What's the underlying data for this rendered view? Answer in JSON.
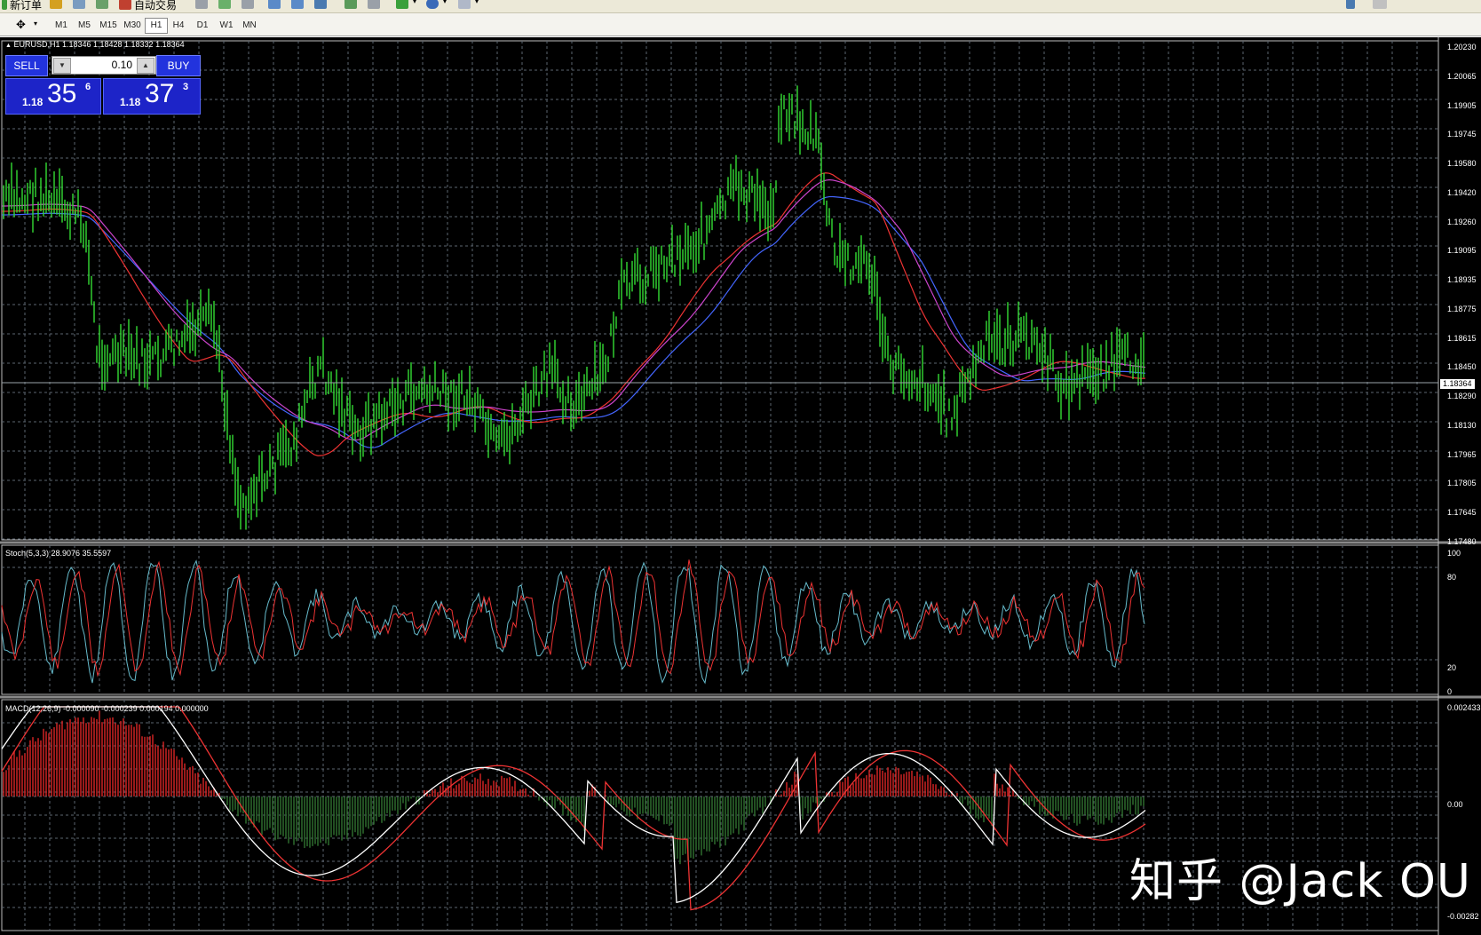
{
  "toolbar": {
    "new_order_label": "新订单",
    "autotrading_label": "自动交易",
    "timeframes": [
      "M1",
      "M5",
      "M15",
      "M30",
      "H1",
      "H4",
      "D1",
      "W1",
      "MN"
    ],
    "active_timeframe": "H1"
  },
  "main_chart": {
    "header": "EURUSD,H1  1.18346 1.18428 1.18332 1.18364",
    "price_axis": [
      "1.20230",
      "1.20065",
      "1.19905",
      "1.19745",
      "1.19580",
      "1.19420",
      "1.19260",
      "1.19095",
      "1.18935",
      "1.18775",
      "1.18615",
      "1.18450",
      "1.18290",
      "1.18130",
      "1.17965",
      "1.17805",
      "1.17645",
      "1.17480"
    ],
    "current_price": "1.18364",
    "candle_color": "#33dd33",
    "ma_colors": [
      "#4466ff",
      "#ee3333",
      "#cc44cc"
    ]
  },
  "trade_panel": {
    "sell_label": "SELL",
    "buy_label": "BUY",
    "volume": "0.10",
    "bid_prefix": "1.18",
    "bid_big": "35",
    "bid_sup": "6",
    "ask_prefix": "1.18",
    "ask_big": "37",
    "ask_sup": "3"
  },
  "stochastic": {
    "header": "Stoch(5,3,3) 28.9076 35.5597",
    "levels": [
      "100",
      "80",
      "20",
      "0"
    ],
    "main_color": "#66bbcc",
    "signal_color": "#ee3333"
  },
  "macd": {
    "header": "MACD(12,26,9) -0.000090 -0.000239 0.000194 0.000000",
    "axis": [
      "0.002433",
      "0.00",
      "-0.00282"
    ],
    "line_color": "#ffffff",
    "signal_color": "#ee3333"
  },
  "watermark": "知乎 @Jack OU"
}
